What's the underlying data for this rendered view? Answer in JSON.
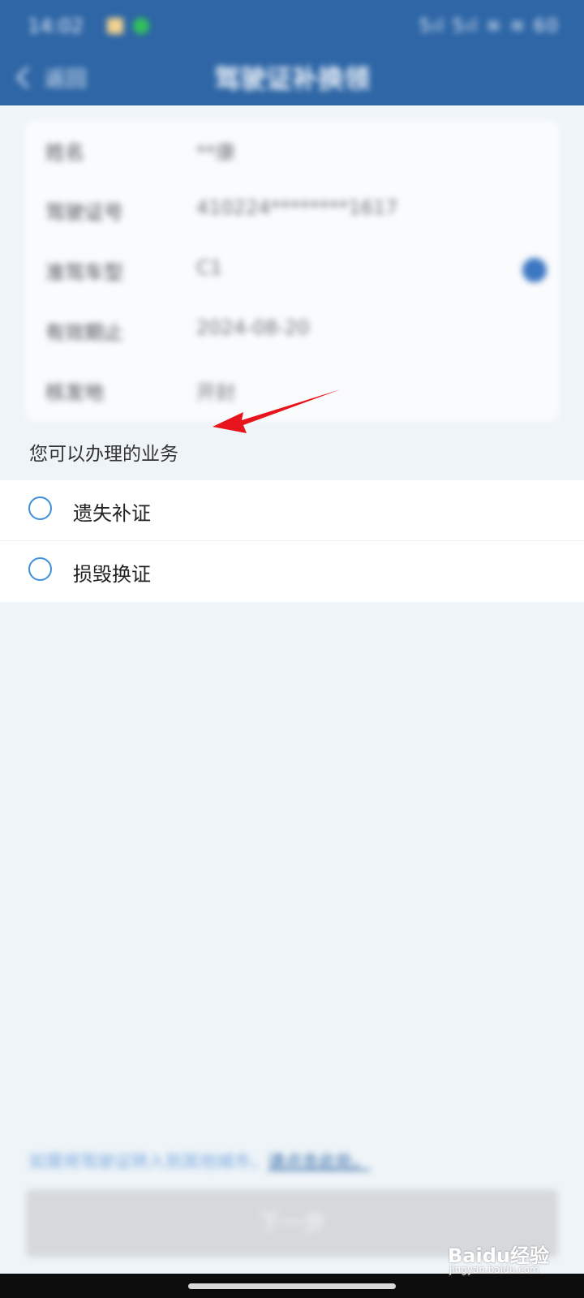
{
  "status_bar": {
    "time": "14:02",
    "right": "5ıl 5ıl ≋ ≋ 60"
  },
  "nav": {
    "back_label": "返回",
    "title": "驾驶证补换领"
  },
  "info_card": {
    "rows": [
      {
        "label": "姓名",
        "value": "**康"
      },
      {
        "label": "驾驶证号",
        "value": "410224********1617"
      },
      {
        "label": "准驾车型",
        "value": "C1"
      },
      {
        "label": "有效期止",
        "value": "2024-08-20"
      },
      {
        "label": "核发地",
        "value": "开封"
      }
    ]
  },
  "section": {
    "title": "您可以办理的业务"
  },
  "options": [
    {
      "label": "遗失补证",
      "selected": false
    },
    {
      "label": "损毁换证",
      "selected": false
    }
  ],
  "footer": {
    "note": "如需将驾驶证转入到其他城市，",
    "link": "请点击此处。",
    "next_label": "下一步"
  },
  "watermark": {
    "brand": "Baidu经验",
    "url": "jingyan.baidu.com"
  },
  "colors": {
    "header_blue": "#2e66a6",
    "radio_blue": "#3f8fda",
    "annotation_red": "#e8141b",
    "disabled_button": "#d6d9dc"
  },
  "icons": {
    "back": "chevron-left-icon",
    "help": "question-circle-icon",
    "annotation": "red-arrow"
  }
}
